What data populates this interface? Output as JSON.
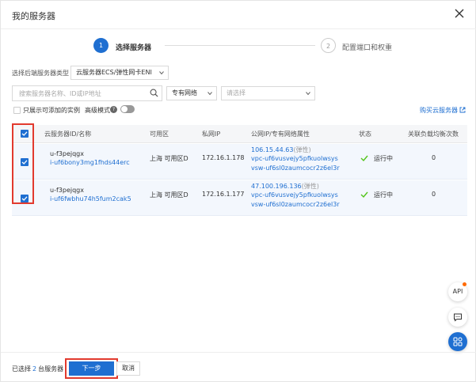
{
  "dialog": {
    "title": "我的服务器"
  },
  "steps": [
    {
      "number": "1",
      "label": "选择服务器"
    },
    {
      "number": "2",
      "label": "配置端口和权重"
    }
  ],
  "filters": {
    "type_label": "选择后端服务器类型",
    "type_value": "云服务器ECS/弹性网卡ENI",
    "search_placeholder": "搜索服务器名称、ID或IP地址",
    "network_value": "专有网络",
    "choose_placeholder": "请选择",
    "only_addable_label": "只展示可添加的实例",
    "advanced_label": "高级模式",
    "help_symbol": "?",
    "buy_link": "购买云服务器"
  },
  "table": {
    "columns": [
      "云服务器ID/名称",
      "可用区",
      "私网IP",
      "公网IP/专有网络属性",
      "状态",
      "关联负载均衡次数"
    ],
    "rows": [
      {
        "name": "u-f3pejqgx",
        "id": "i-uf6bony3mg1fhds44erc",
        "zone": "上海 可用区D",
        "private_ip": "172.16.1.178",
        "public_ip": "106.15.44.63",
        "public_ip_tag": "(弹性)",
        "vpc": "vpc-uf6vusvejy5pfkuolwsys",
        "vsw": "vsw-uf6sl0zaumcocr2z6el3r",
        "status": "运行中",
        "lb_count": "0",
        "checked": true
      },
      {
        "name": "u-f3pejqgx",
        "id": "i-uf6fwbhu74h5fum2cak5",
        "zone": "上海 可用区D",
        "private_ip": "172.16.1.177",
        "public_ip": "47.100.196.136",
        "public_ip_tag": "(弹性)",
        "vpc": "vpc-uf6vusvejy5pfkuolwsys",
        "vsw": "vsw-uf6sl0zaumcocr2z6el3r",
        "status": "运行中",
        "lb_count": "0",
        "checked": true
      }
    ]
  },
  "footer": {
    "summary_prefix": "已选择",
    "summary_count": "2",
    "summary_suffix": "台服务器",
    "next_label": "下一步",
    "cancel_label": "取消"
  },
  "floating": {
    "api_label": "API"
  },
  "icons": {
    "close": "close-icon",
    "search": "search-icon",
    "caret": "chevron-down-icon",
    "external": "external-link-icon",
    "status_ok": "check-icon",
    "message": "message-icon",
    "apps": "apps-grid-icon"
  },
  "colors": {
    "primary": "#1f6fd1",
    "highlight_border": "#e23a2e",
    "status_ok": "#52c41a",
    "notification_dot": "#ff6a00"
  }
}
